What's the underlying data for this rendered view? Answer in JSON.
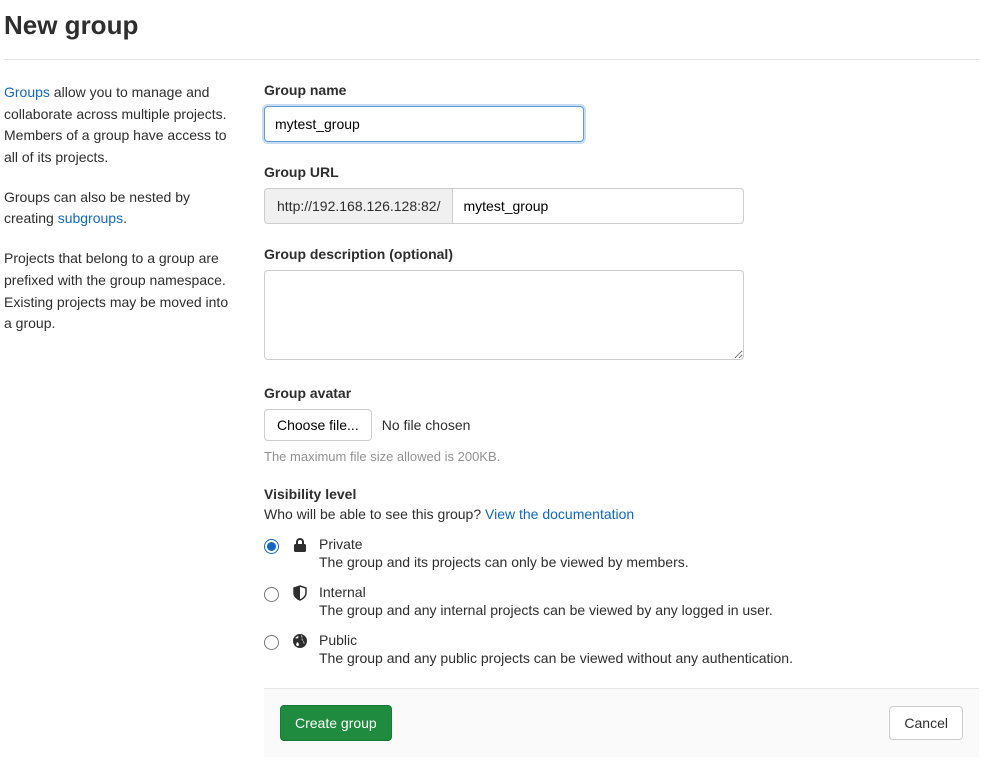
{
  "page_title": "New group",
  "sidebar": {
    "p1_link": "Groups",
    "p1_rest": " allow you to manage and collaborate across multiple projects. Members of a group have access to all of its projects.",
    "p2_pre": "Groups can also be nested by creating ",
    "p2_link": "subgroups",
    "p2_post": ".",
    "p3": "Projects that belong to a group are prefixed with the group namespace. Existing projects may be moved into a group."
  },
  "form": {
    "group_name": {
      "label": "Group name",
      "value": "mytest_group"
    },
    "group_url": {
      "label": "Group URL",
      "prefix": "http://192.168.126.128:82/",
      "value": "mytest_group"
    },
    "group_desc": {
      "label": "Group description (optional)",
      "value": ""
    },
    "group_avatar": {
      "label": "Group avatar",
      "choose_btn": "Choose file...",
      "status": "No file chosen",
      "hint": "The maximum file size allowed is 200KB."
    },
    "visibility": {
      "label": "Visibility level",
      "desc_pre": "Who will be able to see this group? ",
      "doc_link": "View the documentation",
      "options": [
        {
          "key": "private",
          "title": "Private",
          "sub": "The group and its projects can only be viewed by members.",
          "checked": true
        },
        {
          "key": "internal",
          "title": "Internal",
          "sub": "The group and any internal projects can be viewed by any logged in user.",
          "checked": false
        },
        {
          "key": "public",
          "title": "Public",
          "sub": "The group and any public projects can be viewed without any authentication.",
          "checked": false
        }
      ]
    }
  },
  "footer": {
    "submit": "Create group",
    "cancel": "Cancel"
  }
}
